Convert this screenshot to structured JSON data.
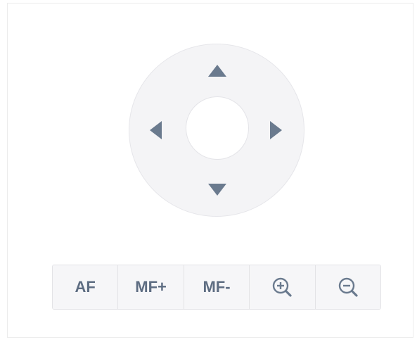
{
  "ptz": {
    "direction_pad": {
      "up": "arrow-up-icon",
      "down": "arrow-down-icon",
      "left": "arrow-left-icon",
      "right": "arrow-right-icon"
    },
    "buttons": {
      "af_label": "AF",
      "mf_plus_label": "MF+",
      "mf_minus_label": "MF-",
      "zoom_in_icon": "zoom-in-icon",
      "zoom_out_icon": "zoom-out-icon"
    },
    "colors": {
      "icon": "#6a7a8e",
      "label": "#5e6d82",
      "pad_background": "#f4f4f6"
    }
  }
}
